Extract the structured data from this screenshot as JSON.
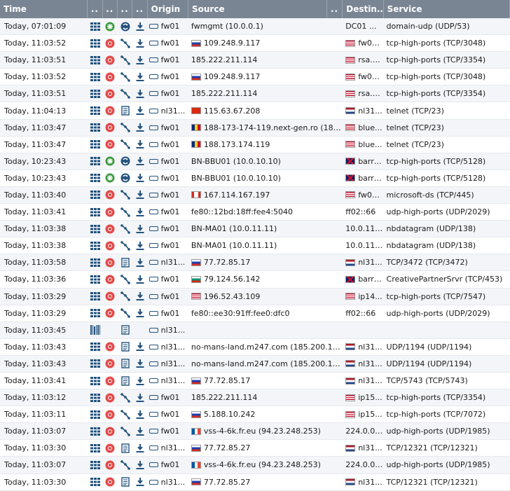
{
  "header": {
    "time": "Time",
    "col1": "..",
    "col2": "..",
    "col3": "..",
    "col4": "..",
    "origin": "Origin",
    "source": "Source",
    "srcmore": "..",
    "destination": "Destin...",
    "service": "Service"
  },
  "colors": {
    "header_bg": "#7a8593",
    "block_red": "#e34a4a",
    "allow_green": "#3a9a3a",
    "icon_blue": "#23527c"
  },
  "rows": [
    {
      "time": "Today, 07:01:09",
      "a": "grid",
      "b": "allow",
      "c": "nat",
      "d": "download",
      "origin": "fw01",
      "flag": "",
      "source": "fwmgmt (10.0.0.1)",
      "dflag": "",
      "dest": "DC01 ...",
      "service": "domain-udp (UDP/53)"
    },
    {
      "time": "Today, 11:03:52",
      "a": "grid",
      "b": "block",
      "c": "route",
      "d": "download",
      "origin": "fw01",
      "flag": "ru",
      "source": "109.248.9.117",
      "dflag": "us",
      "dest": "fw01...",
      "service": "tcp-high-ports (TCP/3048)"
    },
    {
      "time": "Today, 11:03:51",
      "a": "grid",
      "b": "block",
      "c": "route",
      "d": "download",
      "origin": "fw01",
      "flag": "",
      "source": "185.222.211.114",
      "dflag": "us",
      "dest": "rsa.n...",
      "service": "tcp-high-ports (TCP/3354)"
    },
    {
      "time": "Today, 11:03:52",
      "a": "grid",
      "b": "block",
      "c": "route",
      "d": "download",
      "origin": "fw01",
      "flag": "ru",
      "source": "109.248.9.117",
      "dflag": "us",
      "dest": "fw01...",
      "service": "tcp-high-ports (TCP/3048)"
    },
    {
      "time": "Today, 11:03:51",
      "a": "grid",
      "b": "block",
      "c": "route",
      "d": "download",
      "origin": "fw01",
      "flag": "",
      "source": "185.222.211.114",
      "dflag": "us",
      "dest": "rsa.n...",
      "service": "tcp-high-ports (TCP/3354)"
    },
    {
      "time": "Today, 11:04:13",
      "a": "grid",
      "b": "block",
      "c": "doc",
      "d": "download",
      "origin": "nl31...",
      "flag": "cn",
      "source": "115.63.67.208",
      "dflag": "nl",
      "dest": "nl31...",
      "service": "telnet (TCP/23)"
    },
    {
      "time": "Today, 11:03:47",
      "a": "grid",
      "b": "block",
      "c": "route",
      "d": "download",
      "origin": "fw01",
      "flag": "ro",
      "source": "188-173-174-119.next-gen.ro (188....",
      "dflag": "us",
      "dest": "blue...",
      "service": "telnet (TCP/23)"
    },
    {
      "time": "Today, 11:03:47",
      "a": "grid",
      "b": "block",
      "c": "route",
      "d": "download",
      "origin": "fw01",
      "flag": "ro",
      "source": "188.173.174.119",
      "dflag": "us",
      "dest": "blue...",
      "service": "telnet (TCP/23)"
    },
    {
      "time": "Today, 10:23:43",
      "a": "grid",
      "b": "allow",
      "c": "nat",
      "d": "download",
      "origin": "fw01",
      "flag": "",
      "source": "BN-BBU01 (10.0.10.10)",
      "dflag": "gb",
      "dest": "barra...",
      "service": "tcp-high-ports (TCP/5128)"
    },
    {
      "time": "Today, 10:23:43",
      "a": "grid",
      "b": "allow",
      "c": "nat",
      "d": "download",
      "origin": "fw01",
      "flag": "",
      "source": "BN-BBU01 (10.0.10.10)",
      "dflag": "gb",
      "dest": "barra...",
      "service": "tcp-high-ports (TCP/5128)"
    },
    {
      "time": "Today, 11:03:40",
      "a": "grid",
      "b": "block",
      "c": "route",
      "d": "download",
      "origin": "fw01",
      "flag": "ca",
      "source": "167.114.167.197",
      "dflag": "us",
      "dest": "fw01...",
      "service": "microsoft-ds (TCP/445)"
    },
    {
      "time": "Today, 11:03:41",
      "a": "grid",
      "b": "block",
      "c": "route",
      "d": "download",
      "origin": "fw01",
      "flag": "",
      "source": "fe80::12bd:18ff:fee4:5040",
      "dflag": "",
      "dest": "ff02::66",
      "service": "udp-high-ports (UDP/2029)"
    },
    {
      "time": "Today, 11:03:38",
      "a": "grid",
      "b": "block",
      "c": "route",
      "d": "download",
      "origin": "fw01",
      "flag": "",
      "source": "BN-MA01 (10.0.11.11)",
      "dflag": "",
      "dest": "10.0.11....",
      "service": "nbdatagram (UDP/138)"
    },
    {
      "time": "Today, 11:03:38",
      "a": "grid",
      "b": "block",
      "c": "route",
      "d": "download",
      "origin": "fw01",
      "flag": "",
      "source": "BN-MA01 (10.0.11.11)",
      "dflag": "",
      "dest": "10.0.11....",
      "service": "nbdatagram (UDP/138)"
    },
    {
      "time": "Today, 11:03:58",
      "a": "grid",
      "b": "block",
      "c": "doc",
      "d": "download",
      "origin": "nl31...",
      "flag": "ru",
      "source": "77.72.85.17",
      "dflag": "nl",
      "dest": "nl31...",
      "service": "TCP/3472 (TCP/3472)"
    },
    {
      "time": "Today, 11:03:36",
      "a": "grid",
      "b": "block",
      "c": "route",
      "d": "download",
      "origin": "fw01",
      "flag": "bg",
      "source": "79.124.56.142",
      "dflag": "gb",
      "dest": "barra...",
      "service": "CreativePartnerSrvr (TCP/453)"
    },
    {
      "time": "Today, 11:03:29",
      "a": "grid",
      "b": "block",
      "c": "route",
      "d": "download",
      "origin": "fw01",
      "flag": "us",
      "source": "196.52.43.109",
      "dflag": "us",
      "dest": "ip14...",
      "service": "tcp-high-ports (TCP/7547)"
    },
    {
      "time": "Today, 11:03:29",
      "a": "grid",
      "b": "block",
      "c": "route",
      "d": "download",
      "origin": "fw01",
      "flag": "",
      "source": "fe80::ee30:91ff:fee0:dfc0",
      "dflag": "",
      "dest": "ff02::66",
      "service": "udp-high-ports (UDP/2029)"
    },
    {
      "time": "Today, 11:03:45",
      "a": "barcode",
      "b": "",
      "c": "doc",
      "d": "",
      "origin": "nl31...",
      "flag": "",
      "source": "",
      "dflag": "",
      "dest": "",
      "service": ""
    },
    {
      "time": "Today, 11:03:43",
      "a": "grid",
      "b": "block",
      "c": "doc",
      "d": "download",
      "origin": "nl31...",
      "flag": "",
      "source": "no-mans-land.m247.com (185.200.11...",
      "dflag": "nl",
      "dest": "nl31...",
      "service": "UDP/1194 (UDP/1194)"
    },
    {
      "time": "Today, 11:03:43",
      "a": "grid",
      "b": "block",
      "c": "doc",
      "d": "download",
      "origin": "nl31...",
      "flag": "",
      "source": "no-mans-land.m247.com (185.200.11...",
      "dflag": "nl",
      "dest": "nl31...",
      "service": "UDP/1194 (UDP/1194)"
    },
    {
      "time": "Today, 11:03:41",
      "a": "grid",
      "b": "block",
      "c": "doc",
      "d": "download",
      "origin": "nl31...",
      "flag": "ru",
      "source": "77.72.85.17",
      "dflag": "nl",
      "dest": "nl31...",
      "service": "TCP/5743 (TCP/5743)"
    },
    {
      "time": "Today, 11:03:12",
      "a": "grid",
      "b": "block",
      "c": "route",
      "d": "download",
      "origin": "fw01",
      "flag": "",
      "source": "185.222.211.114",
      "dflag": "us",
      "dest": "ip15...",
      "service": "tcp-high-ports (TCP/3354)"
    },
    {
      "time": "Today, 11:03:11",
      "a": "grid",
      "b": "block",
      "c": "route",
      "d": "download",
      "origin": "fw01",
      "flag": "ru",
      "source": "5.188.10.242",
      "dflag": "us",
      "dest": "ip15...",
      "service": "tcp-high-ports (TCP/7072)"
    },
    {
      "time": "Today, 11:03:07",
      "a": "grid",
      "b": "block",
      "c": "route",
      "d": "download",
      "origin": "fw01",
      "flag": "fr",
      "source": "vss-4-6k.fr.eu (94.23.248.253)",
      "dflag": "",
      "dest": "224.0.0....",
      "service": "udp-high-ports (UDP/1985)"
    },
    {
      "time": "Today, 11:03:30",
      "a": "grid",
      "b": "block",
      "c": "doc",
      "d": "download",
      "origin": "nl31...",
      "flag": "ru",
      "source": "77.72.85.27",
      "dflag": "nl",
      "dest": "nl31...",
      "service": "TCP/12321 (TCP/12321)"
    },
    {
      "time": "Today, 11:03:07",
      "a": "grid",
      "b": "block",
      "c": "route",
      "d": "download",
      "origin": "fw01",
      "flag": "fr",
      "source": "vss-4-6k.fr.eu (94.23.248.253)",
      "dflag": "",
      "dest": "224.0.0....",
      "service": "udp-high-ports (UDP/1985)"
    },
    {
      "time": "Today, 11:03:30",
      "a": "grid",
      "b": "block",
      "c": "doc",
      "d": "download",
      "origin": "nl31...",
      "flag": "ru",
      "source": "77.72.85.27",
      "dflag": "nl",
      "dest": "nl31...",
      "service": "TCP/12321 (TCP/12321)"
    }
  ]
}
